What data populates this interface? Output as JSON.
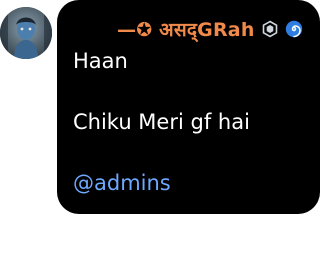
{
  "sender": {
    "name": "—✪ असद्GRah",
    "badge_icon": "hexagon-badge-icon",
    "status_icon": "cyclone-spiral-icon",
    "name_color": "#f08a4b"
  },
  "message": {
    "lines": [
      "Haan",
      "Chiku Meri gf hai"
    ],
    "mention": "@admins",
    "mention_color": "#6ea8ff"
  },
  "avatar": {
    "icon": "profile-picture"
  }
}
